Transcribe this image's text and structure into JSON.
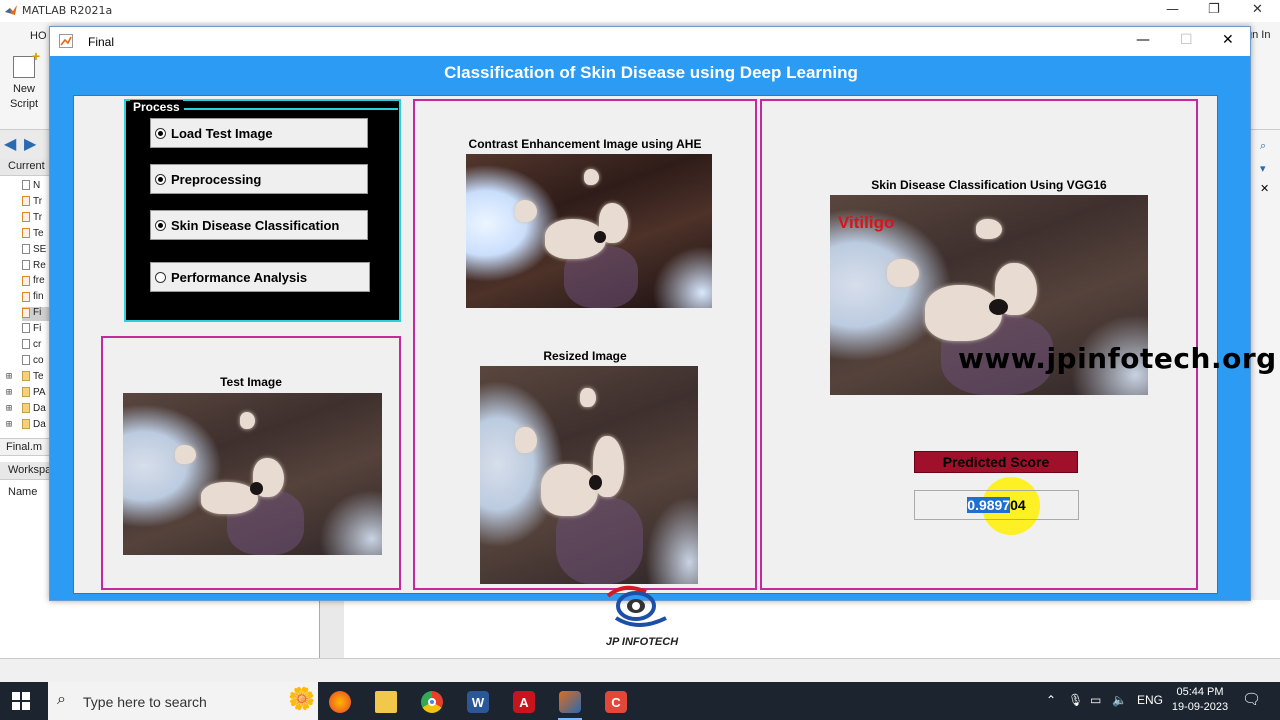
{
  "matlab": {
    "title": "MATLAB R2021a",
    "home_tab": "HO",
    "sign_in": "gn In",
    "new_script_line1": "New",
    "new_script_line2": "Script",
    "current_folder_title": "Current",
    "files": [
      {
        "name": "N",
        "type": "file"
      },
      {
        "name": "Tr",
        "type": "mfile"
      },
      {
        "name": "Tr",
        "type": "mfile"
      },
      {
        "name": "Te",
        "type": "mfile"
      },
      {
        "name": "SE",
        "type": "file"
      },
      {
        "name": "Re",
        "type": "file"
      },
      {
        "name": "fre",
        "type": "mfile"
      },
      {
        "name": "fin",
        "type": "mfile"
      },
      {
        "name": "Fi",
        "type": "mfile"
      },
      {
        "name": "Fi",
        "type": "file"
      },
      {
        "name": "cr",
        "type": "file"
      },
      {
        "name": "co",
        "type": "file"
      },
      {
        "name": "Te",
        "type": "folder"
      },
      {
        "name": "PA",
        "type": "folder"
      },
      {
        "name": "Da",
        "type": "folder"
      },
      {
        "name": "Da",
        "type": "folder"
      }
    ],
    "selected_file_index": 8,
    "details_file": "Final.m",
    "workspace_title": "Workspa",
    "workspace_name_col": "Name"
  },
  "figure": {
    "window_title": "Final",
    "heading": "Classification of Skin Disease using Deep Learning",
    "process": {
      "legend": "Process",
      "options": [
        {
          "label": "Load Test Image",
          "selected": true
        },
        {
          "label": "Preprocessing",
          "selected": true
        },
        {
          "label": "Skin Disease Classification",
          "selected": true
        },
        {
          "label": "Performance Analysis",
          "selected": false
        }
      ]
    },
    "test_image_title": "Test Image",
    "contrast_title": "Contrast Enhancement Image using AHE",
    "resized_title": "Resized Image",
    "classification_title": "Skin Disease Classification Using VGG16",
    "predicted_class": "Vitiligo",
    "watermark": "www.jpinfotech.org",
    "predicted_score_label": "Predicted Score",
    "predicted_score_selected": "0.9897",
    "predicted_score_rest": "04"
  },
  "logo": {
    "text": "JP INFOTECH"
  },
  "taskbar": {
    "search_placeholder": "Type here to search",
    "apps": [
      "firefox-icon",
      "file-explorer-icon",
      "chrome-icon",
      "word-icon",
      "acrobat-icon",
      "matlab-icon",
      "c-app-icon"
    ],
    "language": "ENG",
    "time": "05:44 PM",
    "date": "19-09-2023"
  },
  "colors": {
    "figure_bg": "#2b9bf3",
    "panel_border": "#c42a9b",
    "process_border": "#2ad0e0",
    "predicted_label_bg": "#a0102a",
    "vitiligo_text": "#d8141c"
  }
}
